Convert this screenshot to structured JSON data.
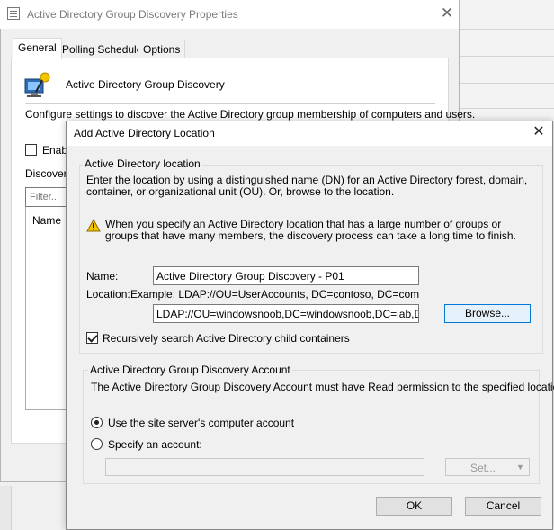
{
  "back_window": {
    "title": "Active Directory Group Discovery Properties",
    "close_glyph": "✕",
    "tabs": [
      {
        "label": "General",
        "active": true
      },
      {
        "label": "Polling Schedule",
        "active": false
      },
      {
        "label": "Options",
        "active": false
      }
    ],
    "heading": "Active Directory Group Discovery",
    "description": "Configure settings to discover the Active Directory group membership of computers and users.",
    "enable_label": "Enabl",
    "discovery_label": "Discovery",
    "filter_placeholder": "Filter...",
    "list_header": "Name"
  },
  "dialog": {
    "title": "Add Active Directory Location",
    "close_glyph": "✕",
    "location_group": {
      "title": "Active Directory location",
      "intro": "Enter the location by using a distinguished name (DN) for an Active Directory forest, domain, container, or organizational unit (OU). Or, browse to the location.",
      "warning": "When you specify an Active Directory location that has a large number of groups or groups that have many members, the discovery process can take a long time to finish.",
      "name_label": "Name:",
      "name_value": "Active Directory Group Discovery - P01",
      "location_label": "Location:",
      "location_example": "Example: LDAP://OU=UserAccounts, DC=contoso, DC=com",
      "location_value": "LDAP://OU=windowsnoob,DC=windowsnoob,DC=lab,DC=local",
      "browse_label": "Browse...",
      "recursive_label": "Recursively search Active Directory child containers",
      "recursive_checked": true
    },
    "account_group": {
      "title": "Active Directory Group Discovery Account",
      "description": "The Active Directory Group Discovery Account must have Read permission to the specified location.",
      "option_computer": "Use the site server's computer account",
      "option_specify": "Specify an account:",
      "selected": "computer",
      "account_value": "",
      "set_label": "Set...",
      "set_arrow": "▼"
    },
    "ok_label": "OK",
    "cancel_label": "Cancel"
  },
  "colors": {
    "accent": "#0078d7",
    "warning": "#f5c400"
  }
}
